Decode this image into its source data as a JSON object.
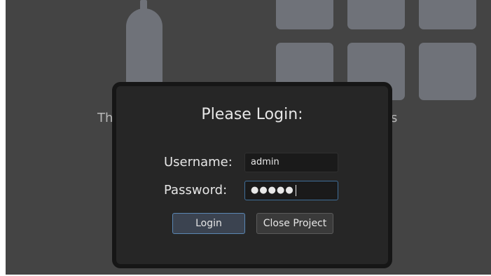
{
  "background": {
    "left_text": "Th",
    "right_text": "s"
  },
  "dialog": {
    "title": "Please Login:",
    "username_label": "Username:",
    "username_value": "admin",
    "password_label": "Password:",
    "password_mask": "●●●●●",
    "login_label": "Login",
    "close_label": "Close Project"
  },
  "colors": {
    "background": "#444444",
    "dialog_bg": "#262626",
    "accent": "#5a86b3"
  }
}
